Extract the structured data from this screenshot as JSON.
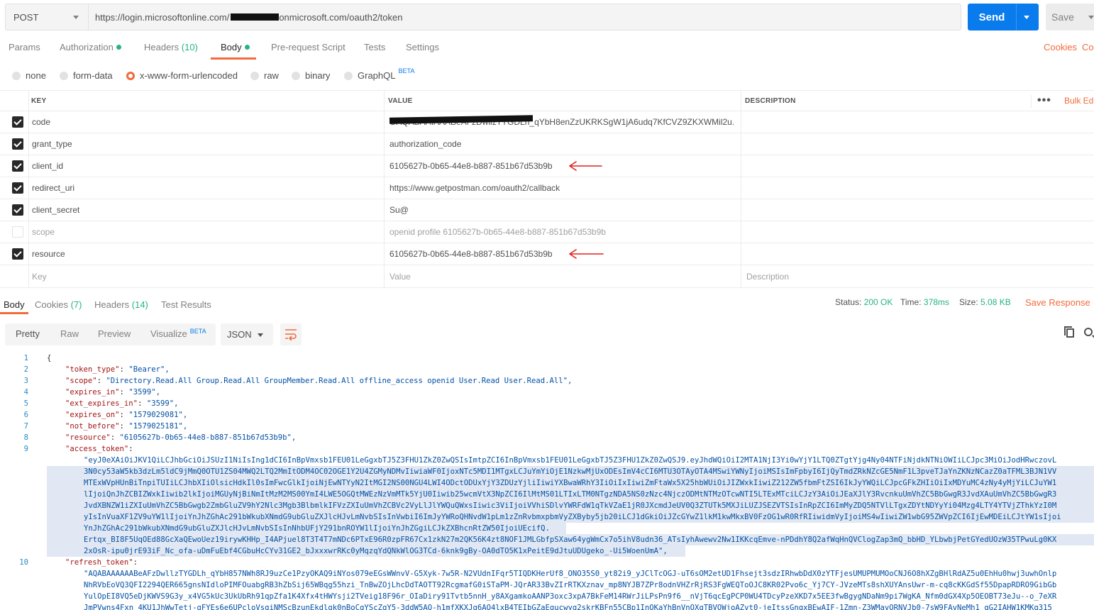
{
  "request": {
    "method": "POST",
    "url_prefix": "https://login.microsoftonline.com/",
    "url_suffix": "onmicrosoft.com/oauth2/token",
    "send_label": "Send",
    "save_label": "Save"
  },
  "request_tabs": {
    "params": "Params",
    "authorization": "Authorization",
    "headers": "Headers",
    "headers_count": "(10)",
    "body": "Body",
    "prerequest": "Pre-request Script",
    "tests": "Tests",
    "settings": "Settings",
    "cookies": "Cookies",
    "code": "Co"
  },
  "body_types": {
    "none": "none",
    "form_data": "form-data",
    "urlencoded": "x-www-form-urlencoded",
    "raw": "raw",
    "binary": "binary",
    "graphql": "GraphQL",
    "beta": "BETA"
  },
  "params_table": {
    "col_key": "KEY",
    "col_value": "VALUE",
    "col_description": "DESCRIPTION",
    "bulk_edit": "Bulk Ed",
    "more": "•••",
    "rows": [
      {
        "key": "code",
        "value": "OAQABAAIAAABeAFzDwllzTYGDLh_qYbH8enZzUKRKSgW1jA6udq7KfCVZ9ZKXWMil2u...",
        "checked": true
      },
      {
        "key": "grant_type",
        "value": "authorization_code",
        "checked": true
      },
      {
        "key": "client_id",
        "value": "6105627b-0b65-44e8-b887-851b67d53b9b",
        "checked": true
      },
      {
        "key": "redirect_uri",
        "value": "https://www.getpostman.com/oauth2/callback",
        "checked": true
      },
      {
        "key": "client_secret",
        "value": "Su@",
        "checked": true
      },
      {
        "key": "scope",
        "value": "openid profile 6105627b-0b65-44e8-b887-851b67d53b9b",
        "checked": false
      },
      {
        "key": "resource",
        "value": "6105627b-0b65-44e8-b887-851b67d53b9b",
        "checked": true
      }
    ],
    "placeholder_key": "Key",
    "placeholder_value": "Value",
    "placeholder_description": "Description"
  },
  "response_tabs": {
    "body": "Body",
    "cookies": "Cookies",
    "cookies_count": "(7)",
    "headers": "Headers",
    "headers_count": "(14)",
    "test_results": "Test Results"
  },
  "response_status": {
    "status_label": "Status:",
    "status_value": "200 OK",
    "time_label": "Time:",
    "time_value": "378ms",
    "size_label": "Size:",
    "size_value": "5.08 KB",
    "save_response": "Save Response"
  },
  "response_toolbar": {
    "pretty": "Pretty",
    "raw": "Raw",
    "preview": "Preview",
    "visualize": "Visualize",
    "beta": "BETA",
    "format": "JSON"
  },
  "response_body": {
    "line_numbers": [
      "1",
      "2",
      "3",
      "4",
      "5",
      "6",
      "7",
      "8",
      "9",
      "10"
    ],
    "open_brace": "{",
    "fields": [
      {
        "key": "\"token_type\"",
        "value": "\"Bearer\","
      },
      {
        "key": "\"scope\"",
        "value": "\"Directory.Read.All Group.Read.All GroupMember.Read.All offline_access openid User.Read User.Read.All\","
      },
      {
        "key": "\"expires_in\"",
        "value": "\"3599\","
      },
      {
        "key": "\"ext_expires_in\"",
        "value": "\"3599\","
      },
      {
        "key": "\"expires_on\"",
        "value": "\"1579029081\","
      },
      {
        "key": "\"not_before\"",
        "value": "\"1579025181\","
      },
      {
        "key": "\"resource\"",
        "value": "\"6105627b-0b65-44e8-b887-851b67d53b9b\","
      },
      {
        "key": "\"access_token\"",
        "value": ""
      }
    ],
    "access_token_lines": [
      "\"eyJ0eXAiOiJKV1QiLCJhbGciOiJSUzI1NiIsIng1dCI6InBpVmxsb1FEU01LeGgxbTJ5Z3FHU1ZkZ0ZwQSIsImtpZCI6InBpVmxsb1FEU01LeGgxbTJ5Z3FHU1ZkZ0ZwQSJ9.eyJhdWQiOiI2MTA1NjI3Yi0wYjY1LTQ0ZTgtYjg4Ny04NTFiNjdkNTNiOWIiLCJpc3MiOiJodHRwczovL",
      "3N0cy53aW5kb3dzLm5ldC9jMmQ0OTU1ZS04MWQ2LTQ2MmItODM4OC02OGE1Y2U4ZGMyNDMvIiwiaWF0IjoxNTc5MDI1MTgxLCJuYmYiOjE1NzkwMjUxODEsImV4cCI6MTU3OTAyOTA4MSwiYWNyIjoiMSIsImFpbyI6IjQyTmdZRkNZcGE5NmF1L3pveTJaYnZKNzNCazZ0aTFML3BJN1VV",
      "MTExWVpHUnBiTnpiTUIiLCJhbXIiOlsicHdkIl0sImFwcGlkIjoiNjEwNTYyN2ItMGI2NS00NGU4LWI4ODctODUxYjY3ZDUzYjliIiwiYXBwaWRhY3IiOiIxIiwiZmFtaWx5X25hbWUiOiJIZWxkIiwiZ212ZW5fbmFtZSI6IkJyYWQiLCJpcGFkZHIiOiIxMDYuMC4zNy4yMjYiLCJuYW1",
      "lIjoiQnJhZCBIZWxkIiwib2lkIjoiMGUyNjBiNmItMzM2MS00YmI4LWE5OGQtMWEzNzVmMTk5YjU0Iiwib25wcmVtX3NpZCI6IlMtMS01LTIxLTM0NTgzNDA5NS0zNzc4NjczODMtNTMzOTcwNTI5LTExMTciLCJzY3AiOiJEaXJlY3RvcnkuUmVhZC5BbGwgR3JvdXAuUmVhZC5BbGwgR3",
      "JvdXBNZW1iZXIuUmVhZC5BbGwgb2ZmbGluZV9hY2Nlc3Mgb3BlbmlkIFVzZXIuUmVhZCBVc2VyLlJlYWQuQWxsIiwic3ViIjoiVVhiSDlvYWRFdW1qTkVZaE1jR0JXcmdJeUV0Q3ZTUTk5MXJiLUZJSEZVTSIsInRpZCI6ImMyZDQ5NTVlLTgxZDYtNDYyYi04Mzg4LTY4YTVjZThkYzI0M",
      "yIsInVuaXF1ZV9uYW1lIjoiYnJhZGhAc291bWkubXNmdG9ubGluZXJlcHJvLmNvbSIsInVwbiI6ImJyYWRoQHNvdW1pLm1zZnRvbmxpbmVyZXByby5jb20iLCJ1dGkiOiJZcGYwZ1lkM1kwMkxBV0FzOG1wR0RfRIiwidmVyIjoiMS4wIiwiZW1wbG95ZWVpZCI6IjEwMDEiLCJtYW1sIjoi",
      "YnJhZGhAc291bWkubXNmdG9ubGluZXJlcHJvLmNvbSIsInNhbUFjY291bnROYW1lIjoiYnJhZGgiLCJkZXBhcnRtZW50IjoiUEcifQ.",
      "Ertqx_BI8F5UqOEd88GcXaQEwoUez19irywKHHp_I4APjuel8T3T4T7mNDc6PTxE96R0zpFR67Cx1zkN27m2QK56K4zt8NOF1JMLGbfpSXaw64ygWmCx7o5ihV8udn36_ATsIyhAwewv2Nw1IKKcqEmve-nPDdhY8Q2afWqHnQVClogZap3mQ_bbHD_YLbwbjPetGYedUOzW35TPwuLg0KX",
      "2xOsR-ipu0jrE93iF_Nc_ofa-uDmFuEbf4CGbuHcCYv31GE2_bJxxxwrRKc0yMqzqYdQNkWlOG3TCd-6knk9gBy-OA0dTO5K1xPeitE9dJtuUDUgeko_-Ui5WoenUmA\","
    ],
    "refresh_key": "\"refresh_token\"",
    "refresh_token_lines": [
      "\"AQABAAAAAABeAFzDwllzTYGDLh_qYbH857NWh8RJ9uzCe1PzyOKAQ9iNYos079eEGsWWnvV-G5Xyk-7w5R-N2VUdnIFqr5TIQDKHerUf8_ONO35S0_yt82i9_yJClTcOGJ-uT6sOM2etUD1Fhsejt3sdzIRhwbDdX0zYTFjesUMUPMUMOoCNJ6O8hXZgBHlRdAZ5u0EhHu0hwj3uwhOnlp",
      "NhRVbEoVQ3QFI2294QER665gnsNIdloPIMFOuabgRB3hZbSij65WBqg55hzi_TnBwZOjLhcDdTAOTT92RcgmafG0iSTaPM-JQrAR33BvZIrRTKXznav_mp8NYJB7ZPr8odnVHZrRjRS3FgWEQToOJC8KR02Pvo6c_Yj7CY-JVzeMTs8shXUYAnsUwr-m-cq8cKKGdSf55DpapRDRO9GibGb",
      "YulOpEI8VQ5eDjKWVS9G3y_x4VG5kUc3UkUbRh91qpZfa1K4Xfx4tHWYsji2TVeig18F96r_OIaDiry91Tvtb5nnH_y8AXgamkoAANP3oxc3xpA7BkFeM14RWrJiLPsPn9f6__nVjT6qcEgPCP0WU4TDcyPzeXKD7x5EE3fwBgygNDaNm9pi7WgKA_Nfm0dGX4Xp5OEOBT73eJu--o_7eXR",
      "JmPVwns4Fxn_4KU1JhWwTetj-gFYEs6e6UPcloVsqiNMScBzunEkdlgk0nBoCqYScZqY5-3ddW5AO-h1mfXKXJg6AO4lxB4TEIbGZaEgucwyg2skrKBFn55CBp1InOKaYhBnVnOXqTBVOWjoAZvt0-jeItssGnqxBEwAIF-1Zmn-Z3WMavORNVJb0-7sW9FAvNeMh1_qG2IAHW1KMKq315"
    ]
  }
}
